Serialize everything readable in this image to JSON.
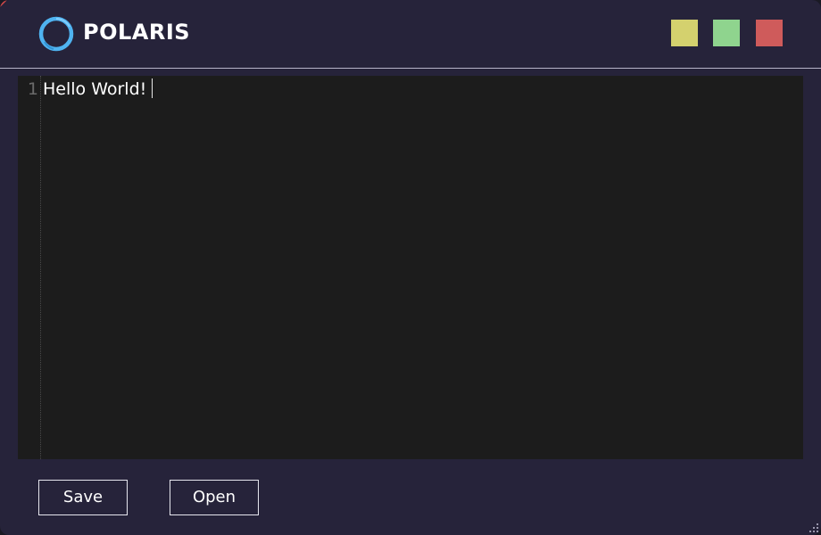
{
  "app": {
    "title": "POLARIS",
    "logo_icon": "ring-logo-icon",
    "accent_color": "#4fb3f0"
  },
  "window_controls": [
    {
      "name": "yellow-button",
      "color": "#d4d16e"
    },
    {
      "name": "green-button",
      "color": "#8fd48e"
    },
    {
      "name": "red-button",
      "color": "#cf5b5b"
    }
  ],
  "editor": {
    "lines": [
      {
        "number": "1",
        "text": "Hello World!"
      }
    ],
    "background": "#1c1c1c"
  },
  "actions": {
    "save_label": "Save",
    "open_label": "Open"
  }
}
